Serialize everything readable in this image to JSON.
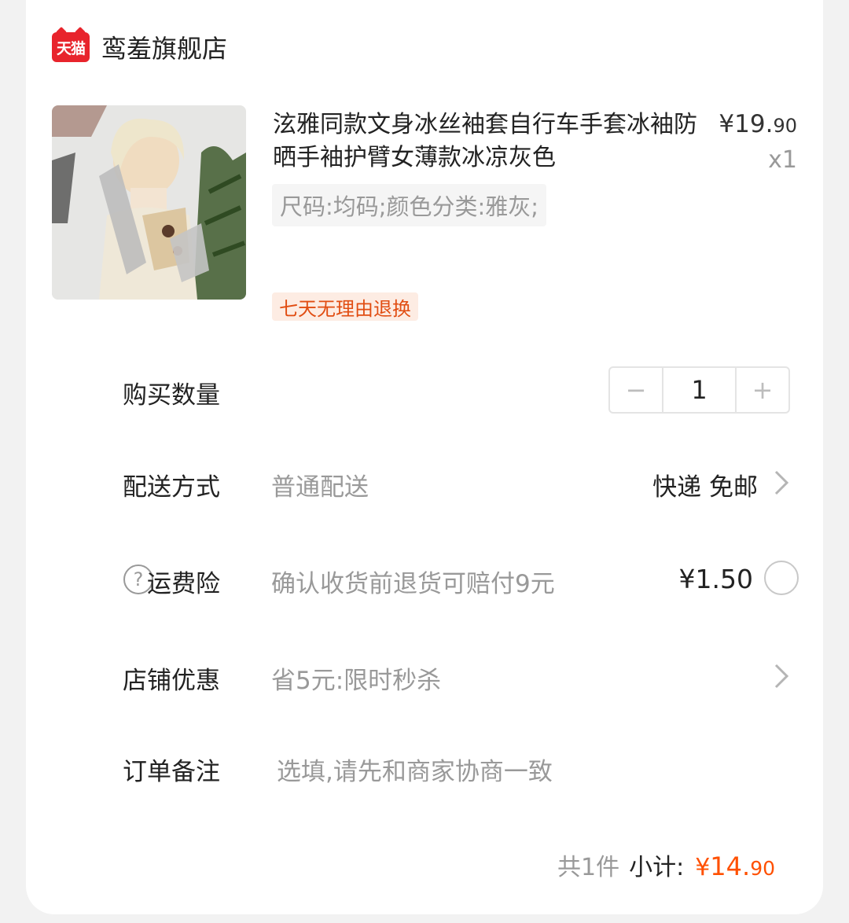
{
  "store": {
    "badge": "天猫",
    "name": "鸾羞旗舰店"
  },
  "product": {
    "title": "泫雅同款文身冰丝袖套自行车手套冰袖防晒手袖护臂女薄款冰凉灰色",
    "price_main": "¥19.",
    "price_cents": "90",
    "quantity_label": "x1",
    "sku": "尺码:均码;颜色分类:雅灰;",
    "return_tag": "七天无理由退换"
  },
  "quantity": {
    "label": "购买数量",
    "minus": "−",
    "value": "1",
    "plus": "+"
  },
  "delivery": {
    "label": "配送方式",
    "value": "普通配送",
    "right": "快递 免邮"
  },
  "insurance": {
    "help": "?",
    "label": "运费险",
    "value": "确认收货前退货可赔付9元",
    "price": "¥1.50"
  },
  "discount": {
    "label": "店铺优惠",
    "value": "省5元:限时秒杀"
  },
  "note": {
    "label": "订单备注",
    "placeholder": "选填,请先和商家协商一致"
  },
  "summary": {
    "count": "共1件",
    "label": "小计:",
    "currency": "¥",
    "amount": "14.",
    "cents": "90"
  },
  "colors": {
    "accent": "#ff5000",
    "tmall_red": "#e8242c",
    "tag_bg": "#fdece3"
  }
}
